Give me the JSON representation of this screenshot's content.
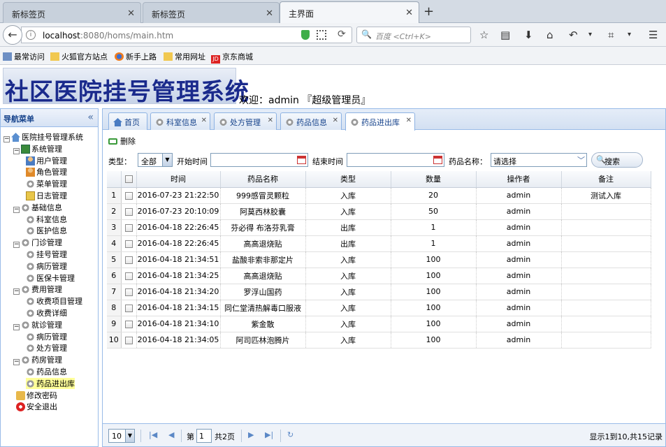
{
  "browser": {
    "tabs": [
      {
        "label": "新标签页",
        "active": false
      },
      {
        "label": "新标签页",
        "active": false
      },
      {
        "label": "主界面",
        "active": true
      }
    ],
    "url_host": "localhost",
    "url_rest": ":8080/homs/main.htm",
    "search_placeholder": "百度 <Ctrl+K>",
    "bookmarks": [
      "最常访问",
      "火狐官方站点",
      "新手上路",
      "常用网址",
      "京东商城"
    ]
  },
  "app": {
    "title": "社区医院挂号管理系统",
    "welcome": "欢迎：admin 『超级管理员』"
  },
  "nav": {
    "header": "导航菜单",
    "collapse": "«",
    "root": "医院挂号管理系统",
    "groups": [
      {
        "label": "系统管理",
        "items": [
          "用户管理",
          "角色管理",
          "菜单管理",
          "日志管理"
        ]
      },
      {
        "label": "基础信息",
        "items": [
          "科室信息",
          "医护信息"
        ]
      },
      {
        "label": "门诊管理",
        "items": [
          "挂号管理",
          "病历管理",
          "医保卡管理"
        ]
      },
      {
        "label": "费用管理",
        "items": [
          "收费项目管理",
          "收费详细"
        ]
      },
      {
        "label": "就诊管理",
        "items": [
          "病历管理",
          "处方管理"
        ]
      },
      {
        "label": "药房管理",
        "items": [
          "药品信息",
          "药品进出库"
        ]
      }
    ],
    "leaves": [
      "修改密码",
      "安全退出"
    ],
    "selected": "药品进出库"
  },
  "tabs": [
    {
      "label": "首页",
      "closable": false
    },
    {
      "label": "科室信息",
      "closable": true
    },
    {
      "label": "处方管理",
      "closable": true
    },
    {
      "label": "药品信息",
      "closable": true
    },
    {
      "label": "药品进出库",
      "closable": true,
      "active": true
    }
  ],
  "toolbar": {
    "delete_label": "删除"
  },
  "filter": {
    "type_label": "类型：",
    "type_value": "全部",
    "start_label": "开始时间",
    "end_label": "结束时间",
    "drug_label": "药品名称：",
    "drug_value": "请选择",
    "search_label": "搜索"
  },
  "grid": {
    "columns": [
      "时间",
      "药品名称",
      "类型",
      "数量",
      "操作者",
      "备注"
    ],
    "rows": [
      {
        "n": "1",
        "time": "2016-07-23 21:22:50",
        "drug": "999感冒灵颗粒",
        "type": "入库",
        "qty": "20",
        "op": "admin",
        "note": "测试入库"
      },
      {
        "n": "2",
        "time": "2016-07-23 20:10:09",
        "drug": "阿莫西林胶囊",
        "type": "入库",
        "qty": "50",
        "op": "admin",
        "note": ""
      },
      {
        "n": "3",
        "time": "2016-04-18 22:26:45",
        "drug": "芬必得 布洛芬乳膏",
        "type": "出库",
        "qty": "1",
        "op": "admin",
        "note": ""
      },
      {
        "n": "4",
        "time": "2016-04-18 22:26:45",
        "drug": "高高退烧贴",
        "type": "出库",
        "qty": "1",
        "op": "admin",
        "note": ""
      },
      {
        "n": "5",
        "time": "2016-04-18 21:34:51",
        "drug": "盐酸非索非那定片",
        "type": "入库",
        "qty": "100",
        "op": "admin",
        "note": ""
      },
      {
        "n": "6",
        "time": "2016-04-18 21:34:25",
        "drug": "高高退烧贴",
        "type": "入库",
        "qty": "100",
        "op": "admin",
        "note": ""
      },
      {
        "n": "7",
        "time": "2016-04-18 21:34:20",
        "drug": "罗浮山国药",
        "type": "入库",
        "qty": "100",
        "op": "admin",
        "note": ""
      },
      {
        "n": "8",
        "time": "2016-04-18 21:34:15",
        "drug": "同仁堂清热解毒口服液",
        "type": "入库",
        "qty": "100",
        "op": "admin",
        "note": ""
      },
      {
        "n": "9",
        "time": "2016-04-18 21:34:10",
        "drug": "紫金散",
        "type": "入库",
        "qty": "100",
        "op": "admin",
        "note": ""
      },
      {
        "n": "10",
        "time": "2016-04-18 21:34:05",
        "drug": "阿司匹林泡腾片",
        "type": "入库",
        "qty": "100",
        "op": "admin",
        "note": ""
      }
    ]
  },
  "pager": {
    "page_size": "10",
    "page_prefix": "第",
    "page_value": "1",
    "total_pages": "共2页",
    "info": "显示1到10,共15记录"
  }
}
